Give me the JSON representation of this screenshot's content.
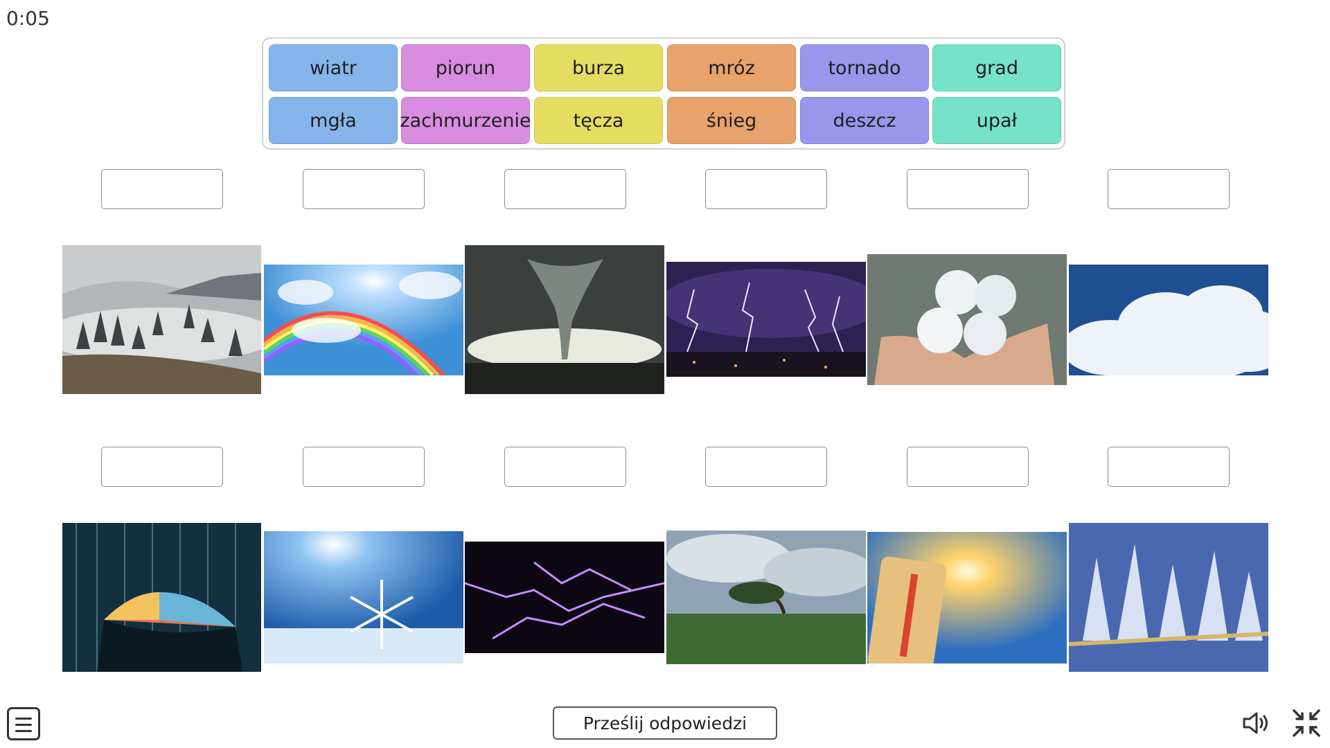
{
  "timer": "0:05",
  "word_tiles": [
    {
      "label": "wiatr",
      "color": "#85b5ea"
    },
    {
      "label": "piorun",
      "color": "#d88de0"
    },
    {
      "label": "burza",
      "color": "#e4dd62"
    },
    {
      "label": "mróz",
      "color": "#e8a26c"
    },
    {
      "label": "tornado",
      "color": "#9b96ec"
    },
    {
      "label": "grad",
      "color": "#76e2c8"
    },
    {
      "label": "mgła",
      "color": "#85b5ea"
    },
    {
      "label": "zachmurzenie",
      "color": "#d88de0"
    },
    {
      "label": "tęcza",
      "color": "#e4dd62"
    },
    {
      "label": "śnieg",
      "color": "#e8a26c"
    },
    {
      "label": "deszcz",
      "color": "#9b96ec"
    },
    {
      "label": "upał",
      "color": "#76e2c8"
    }
  ],
  "photos": [
    "foggy-forest",
    "rainbow",
    "tornado",
    "lightning-storm-city",
    "hailstones-in-hands",
    "cumulus-clouds",
    "rain-umbrella",
    "snowflake",
    "purple-lightning",
    "wind-bent-tree",
    "thermometer-sun",
    "frost-crystals"
  ],
  "submit_label": "Prześlij odpowiedzi",
  "icons": {
    "menu": "menu-icon",
    "sound": "speaker-icon",
    "fullscreen": "exit-fullscreen-icon"
  }
}
